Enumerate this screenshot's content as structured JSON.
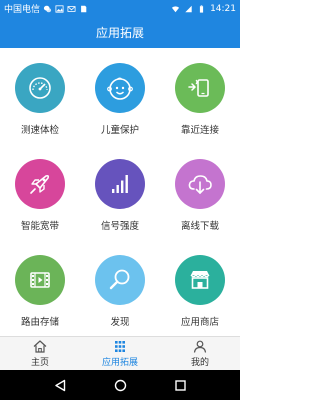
{
  "status_bar": {
    "carrier": "中国电信",
    "time": "14:21",
    "icons": [
      "wechat-icon",
      "image-icon",
      "email-icon",
      "sd-card-icon",
      "wifi-icon",
      "signal-icon",
      "battery-icon"
    ]
  },
  "header": {
    "title": "应用拓展"
  },
  "grid": [
    {
      "label": "测速体检",
      "icon": "speedometer-icon",
      "color": "#3aa6c2"
    },
    {
      "label": "儿童保护",
      "icon": "child-face-icon",
      "color": "#2d9ddf"
    },
    {
      "label": "靠近连接",
      "icon": "nearby-connect-icon",
      "color": "#6bbb58"
    },
    {
      "label": "智能宽带",
      "icon": "rocket-icon",
      "color": "#d7469b"
    },
    {
      "label": "信号强度",
      "icon": "signal-bars-icon",
      "color": "#6653bd"
    },
    {
      "label": "离线下载",
      "icon": "cloud-download-icon",
      "color": "#c474cf"
    },
    {
      "label": "路由存储",
      "icon": "film-storage-icon",
      "color": "#6bb458"
    },
    {
      "label": "发现",
      "icon": "magnifier-icon",
      "color": "#6cc2ee"
    },
    {
      "label": "应用商店",
      "icon": "store-icon",
      "color": "#2bb09d"
    }
  ],
  "bottom_nav": [
    {
      "label": "主页",
      "icon": "home-icon"
    },
    {
      "label": "应用拓展",
      "icon": "grid-apps-icon",
      "active": true
    },
    {
      "label": "我的",
      "icon": "person-icon"
    }
  ],
  "colors": {
    "primary": "#1f86e0"
  }
}
